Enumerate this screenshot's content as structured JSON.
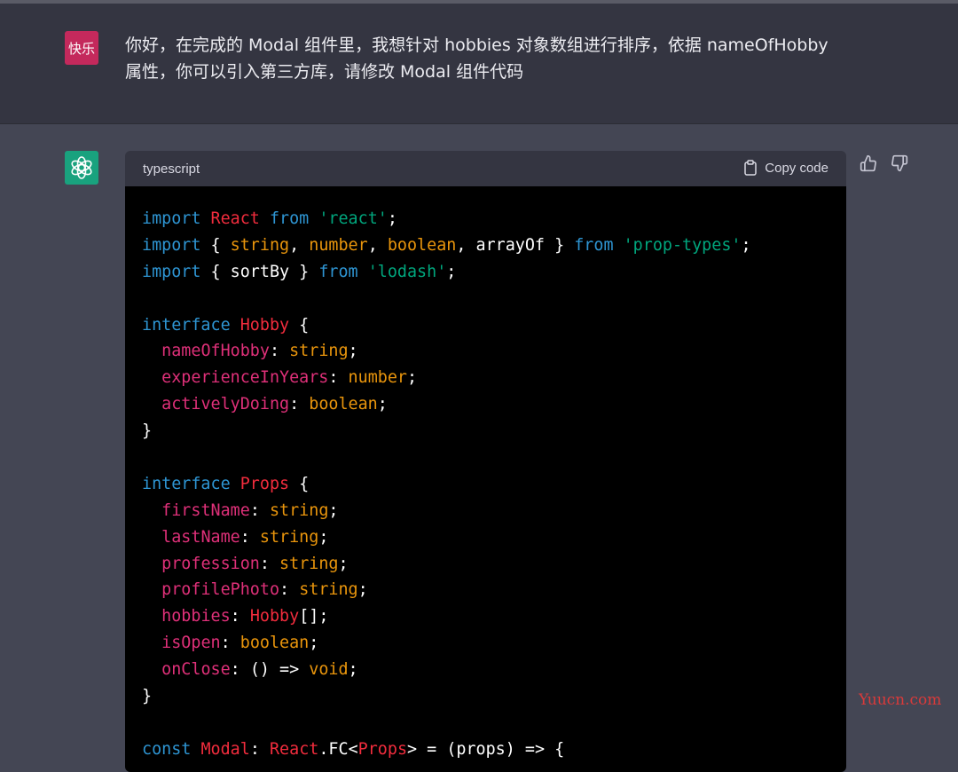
{
  "user": {
    "avatar_text": "快乐",
    "message_line1": "你好，在完成的 Modal 组件里，我想针对 hobbies 对象数组进行排序，依据 nameOfHobby",
    "message_line2": "属性，你可以引入第三方库，请修改 Modal 组件代码"
  },
  "assistant": {
    "avatar_icon": "openai-logo-icon",
    "code_language": "typescript",
    "copy_label": "Copy code",
    "feedback": [
      "thumbs-up-icon",
      "thumbs-down-icon"
    ]
  },
  "code_lines": [
    [
      [
        "kw",
        "import"
      ],
      [
        "pun",
        " "
      ],
      [
        "cls",
        "React"
      ],
      [
        "pun",
        " "
      ],
      [
        "kw",
        "from"
      ],
      [
        "pun",
        " "
      ],
      [
        "str",
        "'react'"
      ],
      [
        "pun",
        ";"
      ]
    ],
    [
      [
        "kw",
        "import"
      ],
      [
        "pun",
        " { "
      ],
      [
        "typ",
        "string"
      ],
      [
        "pun",
        ", "
      ],
      [
        "typ",
        "number"
      ],
      [
        "pun",
        ", "
      ],
      [
        "typ",
        "boolean"
      ],
      [
        "pun",
        ", arrayOf } "
      ],
      [
        "kw",
        "from"
      ],
      [
        "pun",
        " "
      ],
      [
        "str",
        "'prop-types'"
      ],
      [
        "pun",
        ";"
      ]
    ],
    [
      [
        "kw",
        "import"
      ],
      [
        "pun",
        " { sortBy } "
      ],
      [
        "kw",
        "from"
      ],
      [
        "pun",
        " "
      ],
      [
        "str",
        "'lodash'"
      ],
      [
        "pun",
        ";"
      ]
    ],
    [],
    [
      [
        "kw",
        "interface"
      ],
      [
        "pun",
        " "
      ],
      [
        "cls",
        "Hobby"
      ],
      [
        "pun",
        " {"
      ]
    ],
    [
      [
        "pun",
        "  "
      ],
      [
        "prop",
        "nameOfHobby"
      ],
      [
        "pun",
        ": "
      ],
      [
        "typ",
        "string"
      ],
      [
        "pun",
        ";"
      ]
    ],
    [
      [
        "pun",
        "  "
      ],
      [
        "prop",
        "experienceInYears"
      ],
      [
        "pun",
        ": "
      ],
      [
        "typ",
        "number"
      ],
      [
        "pun",
        ";"
      ]
    ],
    [
      [
        "pun",
        "  "
      ],
      [
        "prop",
        "activelyDoing"
      ],
      [
        "pun",
        ": "
      ],
      [
        "typ",
        "boolean"
      ],
      [
        "pun",
        ";"
      ]
    ],
    [
      [
        "pun",
        "}"
      ]
    ],
    [],
    [
      [
        "kw",
        "interface"
      ],
      [
        "pun",
        " "
      ],
      [
        "cls",
        "Props"
      ],
      [
        "pun",
        " {"
      ]
    ],
    [
      [
        "pun",
        "  "
      ],
      [
        "prop",
        "firstName"
      ],
      [
        "pun",
        ": "
      ],
      [
        "typ",
        "string"
      ],
      [
        "pun",
        ";"
      ]
    ],
    [
      [
        "pun",
        "  "
      ],
      [
        "prop",
        "lastName"
      ],
      [
        "pun",
        ": "
      ],
      [
        "typ",
        "string"
      ],
      [
        "pun",
        ";"
      ]
    ],
    [
      [
        "pun",
        "  "
      ],
      [
        "prop",
        "profession"
      ],
      [
        "pun",
        ": "
      ],
      [
        "typ",
        "string"
      ],
      [
        "pun",
        ";"
      ]
    ],
    [
      [
        "pun",
        "  "
      ],
      [
        "prop",
        "profilePhoto"
      ],
      [
        "pun",
        ": "
      ],
      [
        "typ",
        "string"
      ],
      [
        "pun",
        ";"
      ]
    ],
    [
      [
        "pun",
        "  "
      ],
      [
        "prop",
        "hobbies"
      ],
      [
        "pun",
        ": "
      ],
      [
        "cls",
        "Hobby"
      ],
      [
        "pun",
        "[];"
      ]
    ],
    [
      [
        "pun",
        "  "
      ],
      [
        "prop",
        "isOpen"
      ],
      [
        "pun",
        ": "
      ],
      [
        "typ",
        "boolean"
      ],
      [
        "pun",
        ";"
      ]
    ],
    [
      [
        "pun",
        "  "
      ],
      [
        "prop",
        "onClose"
      ],
      [
        "pun",
        ": () => "
      ],
      [
        "typ",
        "void"
      ],
      [
        "pun",
        ";"
      ]
    ],
    [
      [
        "pun",
        "}"
      ]
    ],
    [],
    [
      [
        "kw",
        "const"
      ],
      [
        "pun",
        " "
      ],
      [
        "cls",
        "Modal"
      ],
      [
        "pun",
        ": "
      ],
      [
        "cls",
        "React"
      ],
      [
        "pun",
        ".FC<"
      ],
      [
        "cls",
        "Props"
      ],
      [
        "pun",
        "> = (props) => {"
      ]
    ]
  ],
  "watermark": "Yuucn.com"
}
